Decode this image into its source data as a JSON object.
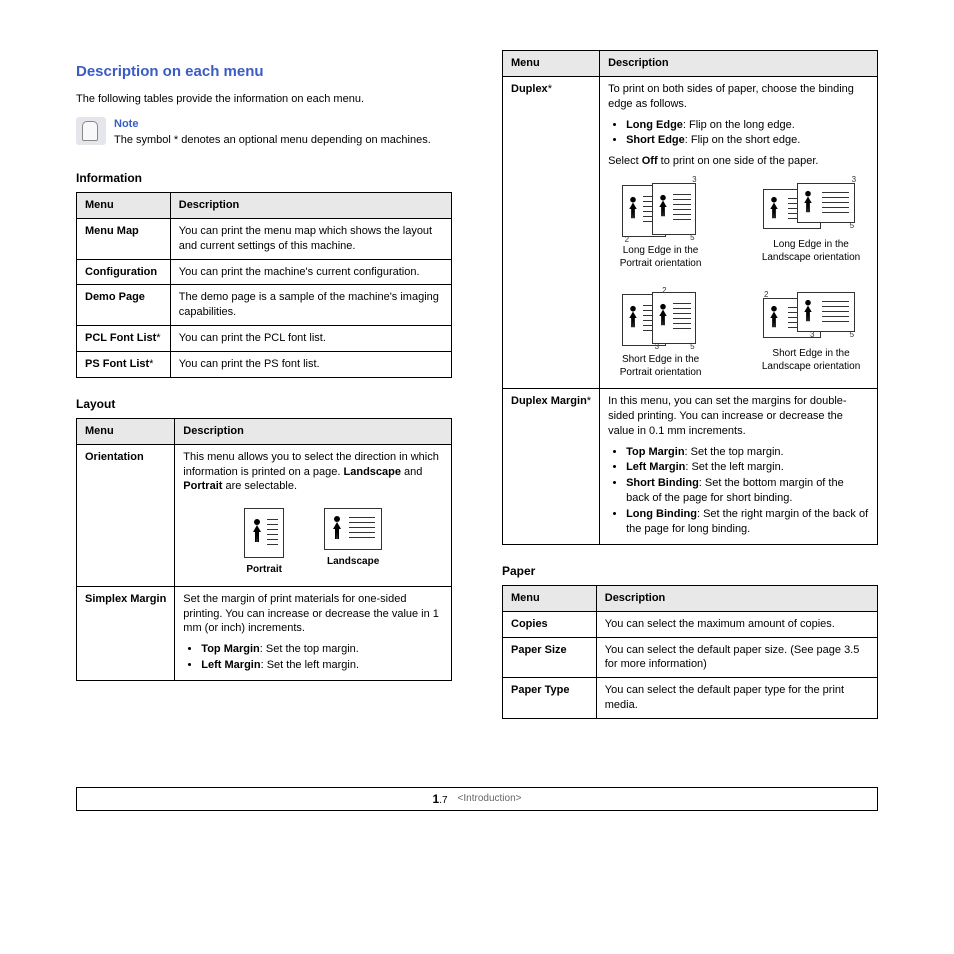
{
  "header": {
    "title": "Description on each menu",
    "intro": "The following tables provide the information on each menu."
  },
  "note": {
    "label": "Note",
    "text": "The symbol * denotes an optional menu depending on machines."
  },
  "table_headers": {
    "menu": "Menu",
    "description": "Description"
  },
  "information": {
    "title": "Information",
    "rows": [
      {
        "name": "Menu Map",
        "desc": "You can print the menu map which shows the layout and current settings of this machine."
      },
      {
        "name": "Configuration",
        "desc": "You can print the machine's current configuration."
      },
      {
        "name": "Demo Page",
        "desc": "The demo page is a sample of the machine's imaging capabilities."
      },
      {
        "name": "PCL Font List",
        "ast": true,
        "desc": "You can print the PCL font list."
      },
      {
        "name": "PS Font List",
        "ast": true,
        "desc": "You can print the PS font list."
      }
    ]
  },
  "layout": {
    "title": "Layout",
    "orientation": {
      "name": "Orientation",
      "desc_pre": "This menu allows you to select the direction in which information is printed on a page. ",
      "desc_bold_a": "Landscape",
      "desc_mid": " and ",
      "desc_bold_b": "Portrait",
      "desc_post": " are selectable.",
      "cap_portrait": "Portrait",
      "cap_landscape": "Landscape"
    },
    "simplex": {
      "name": "Simplex Margin",
      "desc": "Set the margin of print materials for one-sided printing. You can increase or decrease the value in 1 mm (or inch) increments.",
      "bullets": [
        {
          "b": "Top Margin",
          "t": ": Set the top margin."
        },
        {
          "b": "Left Margin",
          "t": ": Set the left margin."
        }
      ]
    },
    "duplex": {
      "name": "Duplex",
      "ast": true,
      "intro": "To print on both sides of paper, choose the binding edge as follows.",
      "bullets": [
        {
          "b": "Long Edge",
          "t": ": Flip on the long edge."
        },
        {
          "b": "Short Edge",
          "t": ": Flip on the short edge."
        }
      ],
      "off_pre": "Select ",
      "off_bold": "Off",
      "off_post": " to print on one side of the paper.",
      "caps": {
        "lep": "Long Edge in the Portrait orientation",
        "lel": "Long Edge in the Landscape orientation",
        "sep": "Short Edge in the Portrait orientation",
        "sel": "Short Edge in the Landscape orientation"
      }
    },
    "duplex_margin": {
      "name": "Duplex Margin",
      "ast": true,
      "desc": "In this menu, you can set the margins for double-sided printing. You can increase or decrease the value in 0.1 mm increments.",
      "bullets": [
        {
          "b": "Top Margin",
          "t": ": Set the top margin."
        },
        {
          "b": "Left Margin",
          "t": ": Set the left margin."
        },
        {
          "b": "Short Binding",
          "t": ": Set the bottom margin of the back of the page for short binding."
        },
        {
          "b": "Long Binding",
          "t": ": Set the right margin of the back of the page for long binding."
        }
      ]
    }
  },
  "paper": {
    "title": "Paper",
    "rows": [
      {
        "name": "Copies",
        "desc": "You can select the maximum amount of copies."
      },
      {
        "name": "Paper Size",
        "desc": "You can select the default paper size. (See page 3.5 for more information)"
      },
      {
        "name": "Paper Type",
        "desc": "You can select the default paper type for the print media."
      }
    ]
  },
  "footer": {
    "chapter": "1",
    "page": ".7",
    "crumb": "<Introduction>"
  }
}
